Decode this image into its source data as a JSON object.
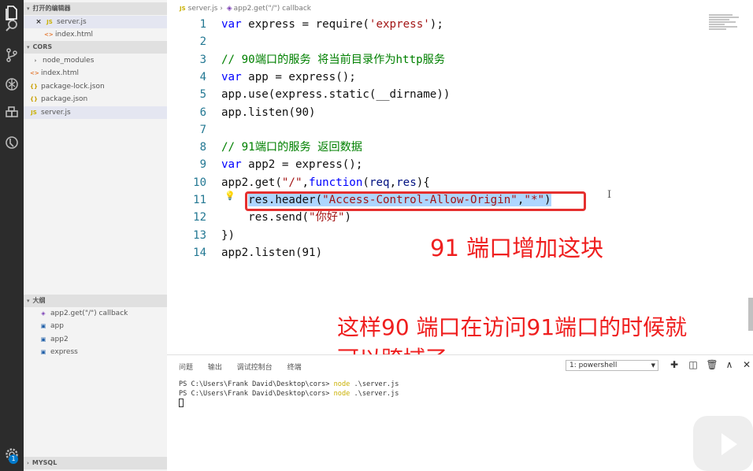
{
  "sidebar": {
    "open_editors": {
      "title": "打开的编辑器",
      "items": [
        {
          "icon": "JS",
          "close": "×",
          "label": "server.js"
        },
        {
          "icon": "<>",
          "label": "index.html"
        }
      ]
    },
    "project": {
      "title": "CORS",
      "items": [
        {
          "icon": "›",
          "label": "node_modules"
        },
        {
          "icon": "<>",
          "label": "index.html"
        },
        {
          "icon": "{}",
          "label": "package-lock.json"
        },
        {
          "icon": "{}",
          "label": "package.json"
        },
        {
          "icon": "JS",
          "label": "server.js"
        }
      ]
    },
    "outline": {
      "title": "大纲",
      "items": [
        {
          "label": "app2.get(\"/\") callback"
        },
        {
          "label": "app"
        },
        {
          "label": "app2"
        },
        {
          "label": "express"
        }
      ]
    },
    "mysql": {
      "title": "MYSQL"
    },
    "badge": "1"
  },
  "editor": {
    "breadcrumb": {
      "file": "server.js",
      "separator": "›",
      "symbol": "app2.get(\"/\") callback"
    },
    "lines": [
      {
        "n": "1",
        "code": "var express = require('express');"
      },
      {
        "n": "2",
        "code": ""
      },
      {
        "n": "3",
        "code": "// 90端口的服务 将当前目录作为http服务"
      },
      {
        "n": "4",
        "code": "var app = express();"
      },
      {
        "n": "5",
        "code": "app.use(express.static(__dirname))"
      },
      {
        "n": "6",
        "code": "app.listen(90)"
      },
      {
        "n": "7",
        "code": ""
      },
      {
        "n": "8",
        "code": "// 91端口的服务 返回数据"
      },
      {
        "n": "9",
        "code": "var app2 = express();"
      },
      {
        "n": "10",
        "code": "app2.get(\"/\",function(req,res){"
      },
      {
        "n": "11",
        "code": "    res.header(\"Access-Control-Allow-Origin\",\"*\")"
      },
      {
        "n": "12",
        "code": "    res.send(\"你好\")"
      },
      {
        "n": "13",
        "code": "})"
      },
      {
        "n": "14",
        "code": "app2.listen(91)"
      }
    ],
    "annotation_1": "91 端口增加这块",
    "annotation_2_line1": "这样90 端口在访问91端口的时候就",
    "annotation_2_line2": "可以跨域了",
    "annotation_color": "#ef1f1f"
  },
  "panel": {
    "tabs": [
      "问题",
      "输出",
      "调试控制台",
      "终端"
    ],
    "shell": "1: powershell",
    "terminal_lines": [
      {
        "prompt": "PS C:\\Users\\Frank David\\Desktop\\cors> ",
        "cmd": "node",
        "args": " .\\server.js"
      },
      {
        "prompt": "PS C:\\Users\\Frank David\\Desktop\\cors> ",
        "cmd": "node",
        "args": " .\\server.js"
      }
    ]
  }
}
